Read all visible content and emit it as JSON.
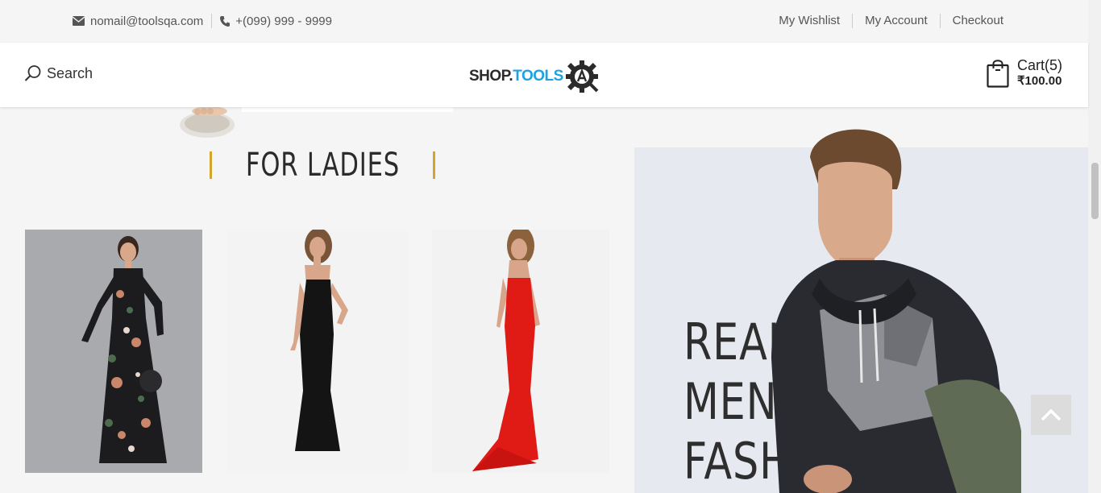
{
  "topbar": {
    "email": "nomail@toolsqa.com",
    "phone": "+(099) 999 - 9999",
    "links": [
      "My Wishlist",
      "My Account",
      "Checkout"
    ]
  },
  "header": {
    "search_label": "Search",
    "logo": {
      "part1": "SHOP.",
      "part2": "TOOLS"
    },
    "cart": {
      "label": "Cart(5)",
      "amount": "₹100.00"
    }
  },
  "ladies": {
    "title": "FOR LADIES",
    "products": [
      {
        "icon": "floral-dress-image"
      },
      {
        "icon": "black-gown-image"
      },
      {
        "icon": "red-gown-image"
      }
    ]
  },
  "men_banner": {
    "lines": [
      "REAL",
      "MEN'S",
      "FASHION"
    ]
  },
  "colors": {
    "accent": "#d4a52c",
    "logo_blue": "#1fa2e0",
    "background": "#f5f5f5"
  }
}
